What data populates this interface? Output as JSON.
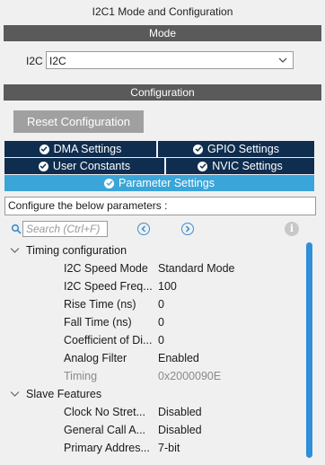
{
  "title": "I2C1 Mode and Configuration",
  "mode": {
    "header": "Mode",
    "i2c_label": "I2C",
    "i2c_value": "I2C"
  },
  "configuration": {
    "header": "Configuration",
    "reset_button": "Reset Configuration",
    "tabs": [
      {
        "label": "DMA Settings",
        "active": false
      },
      {
        "label": "GPIO Settings",
        "active": false
      },
      {
        "label": "User Constants",
        "active": false
      },
      {
        "label": "NVIC Settings",
        "active": false
      },
      {
        "label": "Parameter Settings",
        "active": true
      }
    ],
    "describe_text": "Configure the below parameters :",
    "search_placeholder": "Search (Ctrl+F)",
    "groups": [
      {
        "name": "Timing configuration",
        "rows": [
          {
            "key": "I2C Speed Mode",
            "value": "Standard Mode",
            "muted": false
          },
          {
            "key": "I2C Speed Freq...",
            "value": "100",
            "muted": false
          },
          {
            "key": "Rise Time (ns)",
            "value": "0",
            "muted": false
          },
          {
            "key": "Fall Time (ns)",
            "value": "0",
            "muted": false
          },
          {
            "key": "Coefficient of Di...",
            "value": "0",
            "muted": false
          },
          {
            "key": "Analog Filter",
            "value": "Enabled",
            "muted": false
          },
          {
            "key": "Timing",
            "value": "0x2000090E",
            "muted": true
          }
        ]
      },
      {
        "name": "Slave Features",
        "rows": [
          {
            "key": "Clock No Stret...",
            "value": "Disabled",
            "muted": false
          },
          {
            "key": "General Call A...",
            "value": "Disabled",
            "muted": false
          },
          {
            "key": "Primary Addres...",
            "value": "7-bit",
            "muted": false
          }
        ]
      }
    ]
  },
  "colors": {
    "tab_bg": "#0f2d4f",
    "tab_active": "#3aa5d8",
    "section_bar": "#5a5a5a",
    "scroll_thumb": "#2f8fd8"
  }
}
